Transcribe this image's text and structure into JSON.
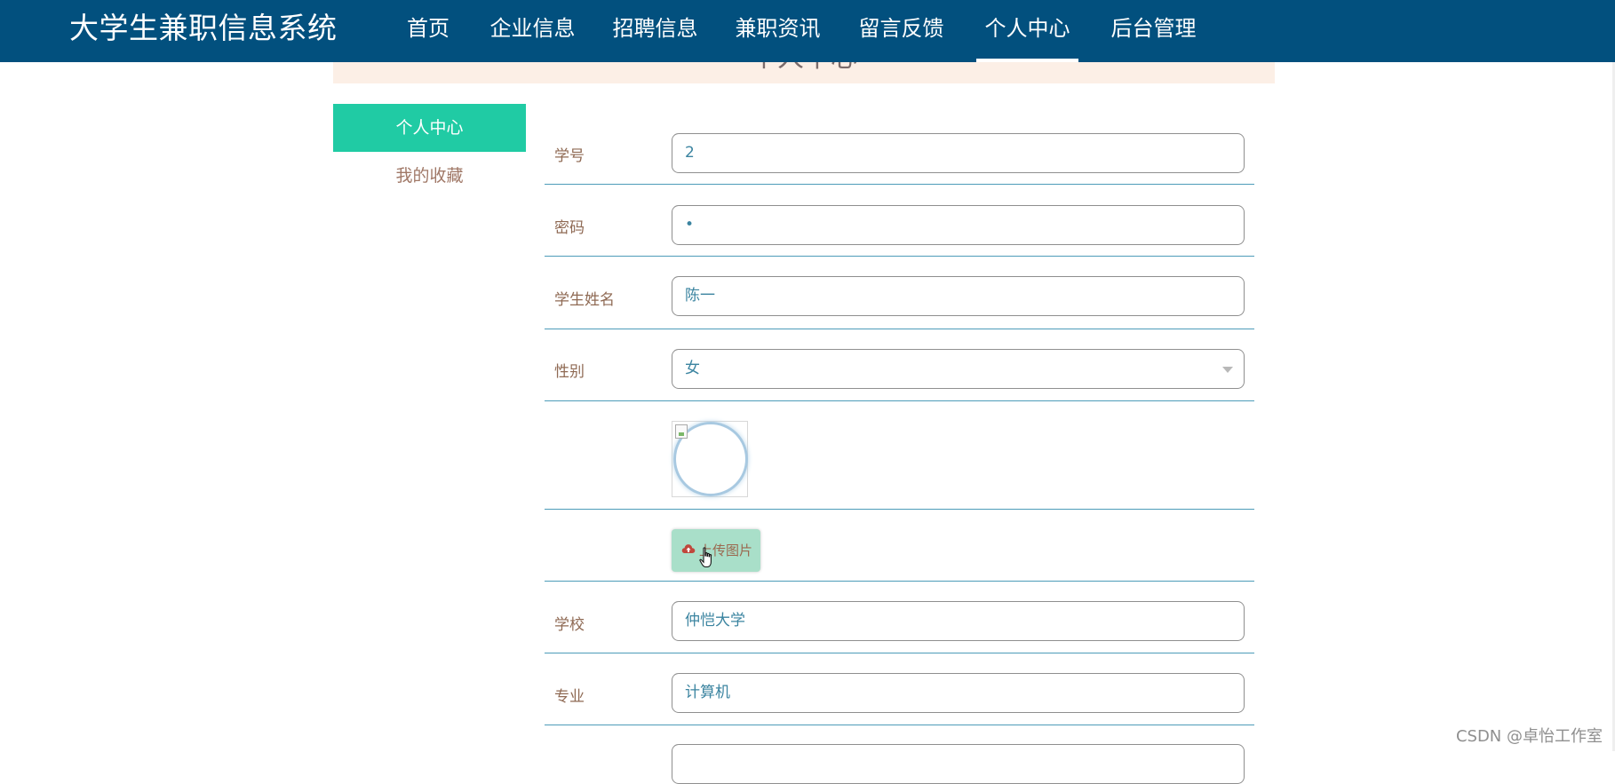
{
  "header": {
    "brand": "大学生兼职信息系统",
    "nav": [
      {
        "label": "首页"
      },
      {
        "label": "企业信息"
      },
      {
        "label": "招聘信息"
      },
      {
        "label": "兼职资讯"
      },
      {
        "label": "留言反馈"
      },
      {
        "label": "个人中心"
      },
      {
        "label": "后台管理"
      }
    ],
    "active_nav": "个人中心"
  },
  "banner": {
    "title": "个人中心"
  },
  "sidebar": {
    "items": [
      {
        "label": "个人中心",
        "active": true
      },
      {
        "label": "我的收藏",
        "active": false
      }
    ]
  },
  "form": {
    "student_id": {
      "label": "学号",
      "value": "2"
    },
    "password": {
      "label": "密码",
      "value": "•"
    },
    "student_name": {
      "label": "学生姓名",
      "value": "陈一"
    },
    "gender": {
      "label": "性别",
      "value": "女"
    },
    "avatar": {
      "icon": "broken-image-icon"
    },
    "upload": {
      "label": "上传图片",
      "icon": "cloud-upload-icon"
    },
    "school": {
      "label": "学校",
      "value": "仲恺大学"
    },
    "major": {
      "label": "专业",
      "value": "计算机"
    }
  },
  "watermark": "CSDN @卓怡工作室",
  "colors": {
    "nav_bg": "#02507e",
    "sidebar_active": "#20cba4",
    "banner_bg": "#fcefe6",
    "upload_button": "#a9dfc9",
    "label_text": "#8f6a54",
    "input_text": "#3b84a0",
    "divider": "#4d9cb9"
  }
}
